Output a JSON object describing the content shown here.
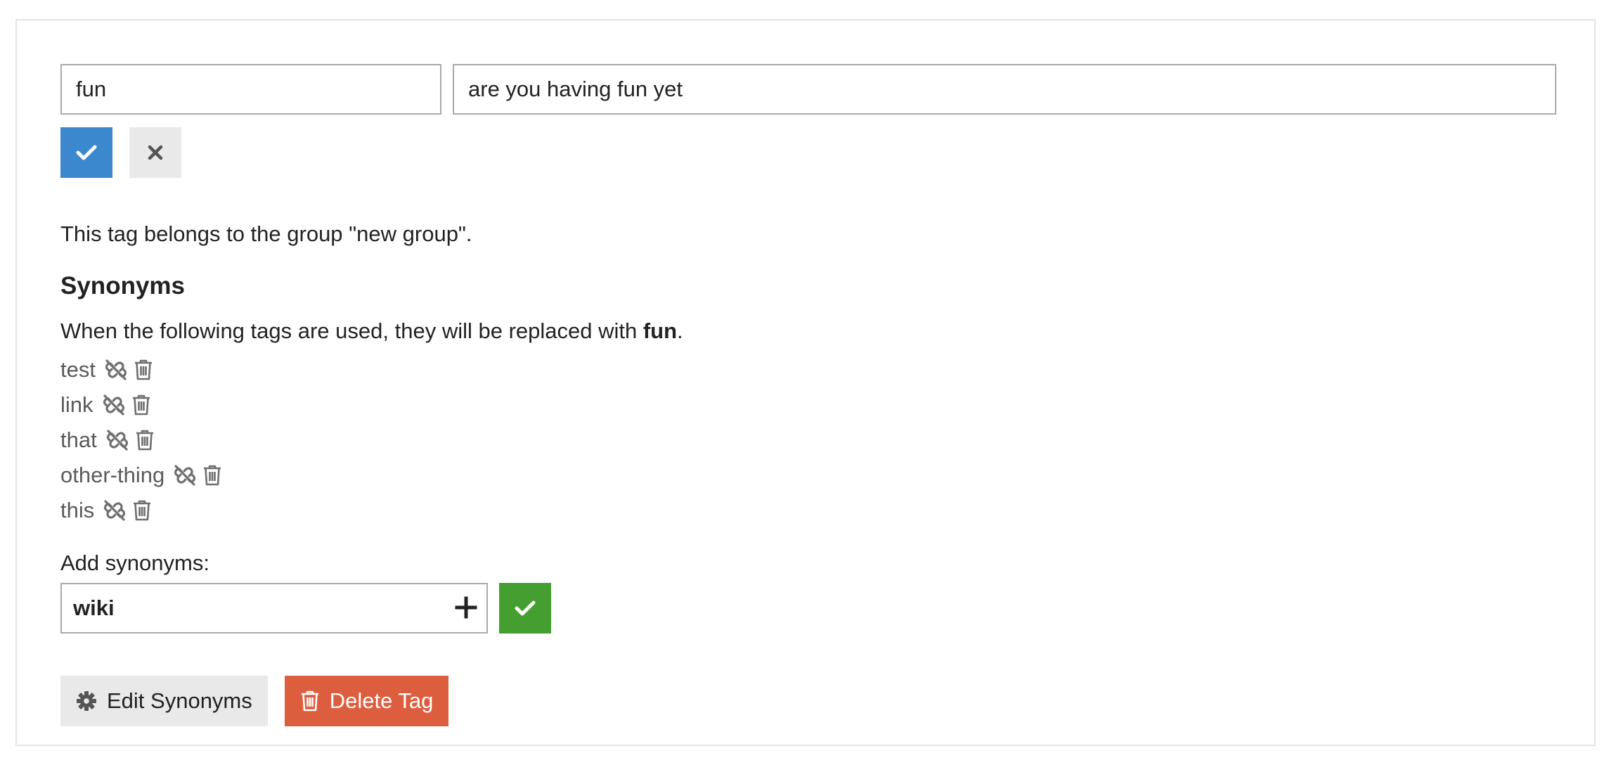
{
  "tag": {
    "name": "fun",
    "description": "are you having fun yet",
    "group_text": "This tag belongs to the group \"new group\"."
  },
  "synonyms": {
    "title": "Synonyms",
    "desc_prefix": "When the following tags are used, they will be replaced with ",
    "desc_tag": "fun",
    "desc_suffix": ".",
    "items": [
      {
        "label": "test"
      },
      {
        "label": "link"
      },
      {
        "label": "that"
      },
      {
        "label": "other-thing"
      },
      {
        "label": "this"
      }
    ],
    "add_label": "Add synonyms:",
    "add_value": "wiki"
  },
  "buttons": {
    "edit_synonyms": "Edit Synonyms",
    "delete_tag": "Delete Tag"
  },
  "icons": {
    "confirm": "check-icon",
    "cancel": "close-icon",
    "unlink": "unlink-icon",
    "trash": "trash-icon",
    "add": "plus-icon",
    "settings": "gear-icon"
  },
  "colors": {
    "confirm_blue": "#3c88ce",
    "confirm_green": "#449e30",
    "delete_red": "#dd5e3f",
    "neutral_grey": "#e9e9e9"
  }
}
